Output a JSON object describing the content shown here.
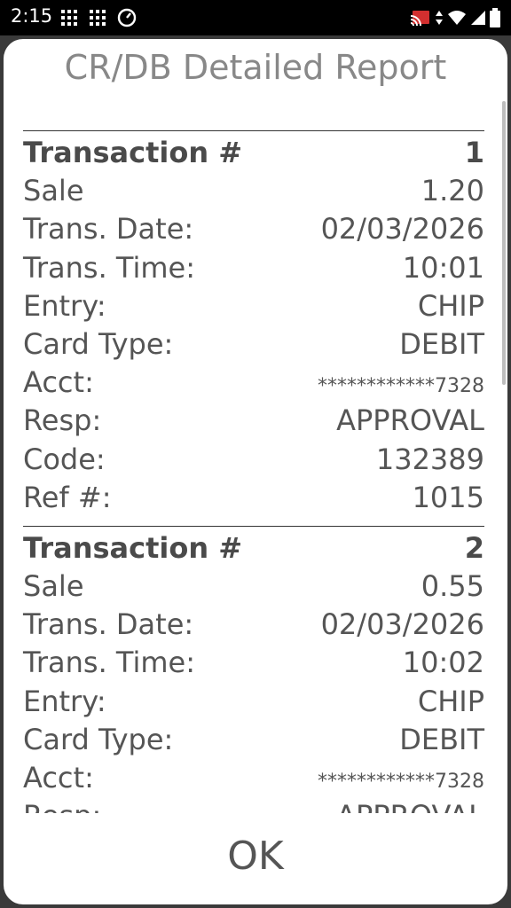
{
  "status_bar": {
    "time": "2:15",
    "icons_left": [
      "grid-icon",
      "grid-icon",
      "gauge-icon"
    ],
    "icons_right": [
      "cast-icon",
      "data-arrows-icon",
      "wifi-icon",
      "signal-icon",
      "battery-icon"
    ]
  },
  "dialog": {
    "title": "CR/DB Detailed Report",
    "ok_label": "OK"
  },
  "labels": {
    "transaction": "Transaction #",
    "sale": "Sale",
    "trans_date": "Trans. Date:",
    "trans_time": "Trans. Time:",
    "entry": "Entry:",
    "card_type": "Card Type:",
    "acct": "Acct:",
    "resp": "Resp:",
    "code": "Code:",
    "ref": "Ref #:"
  },
  "transactions": [
    {
      "number": "1",
      "sale": "1.20",
      "date": "02/03/2026",
      "time": "10:01",
      "entry": "CHIP",
      "card_type": "DEBIT",
      "acct": "************7328",
      "resp": "APPROVAL",
      "code": "132389",
      "ref": "1015"
    },
    {
      "number": "2",
      "sale": "0.55",
      "date": "02/03/2026",
      "time": "10:02",
      "entry": "CHIP",
      "card_type": "DEBIT",
      "acct": "************7328",
      "resp": "APPROVAL"
    }
  ]
}
